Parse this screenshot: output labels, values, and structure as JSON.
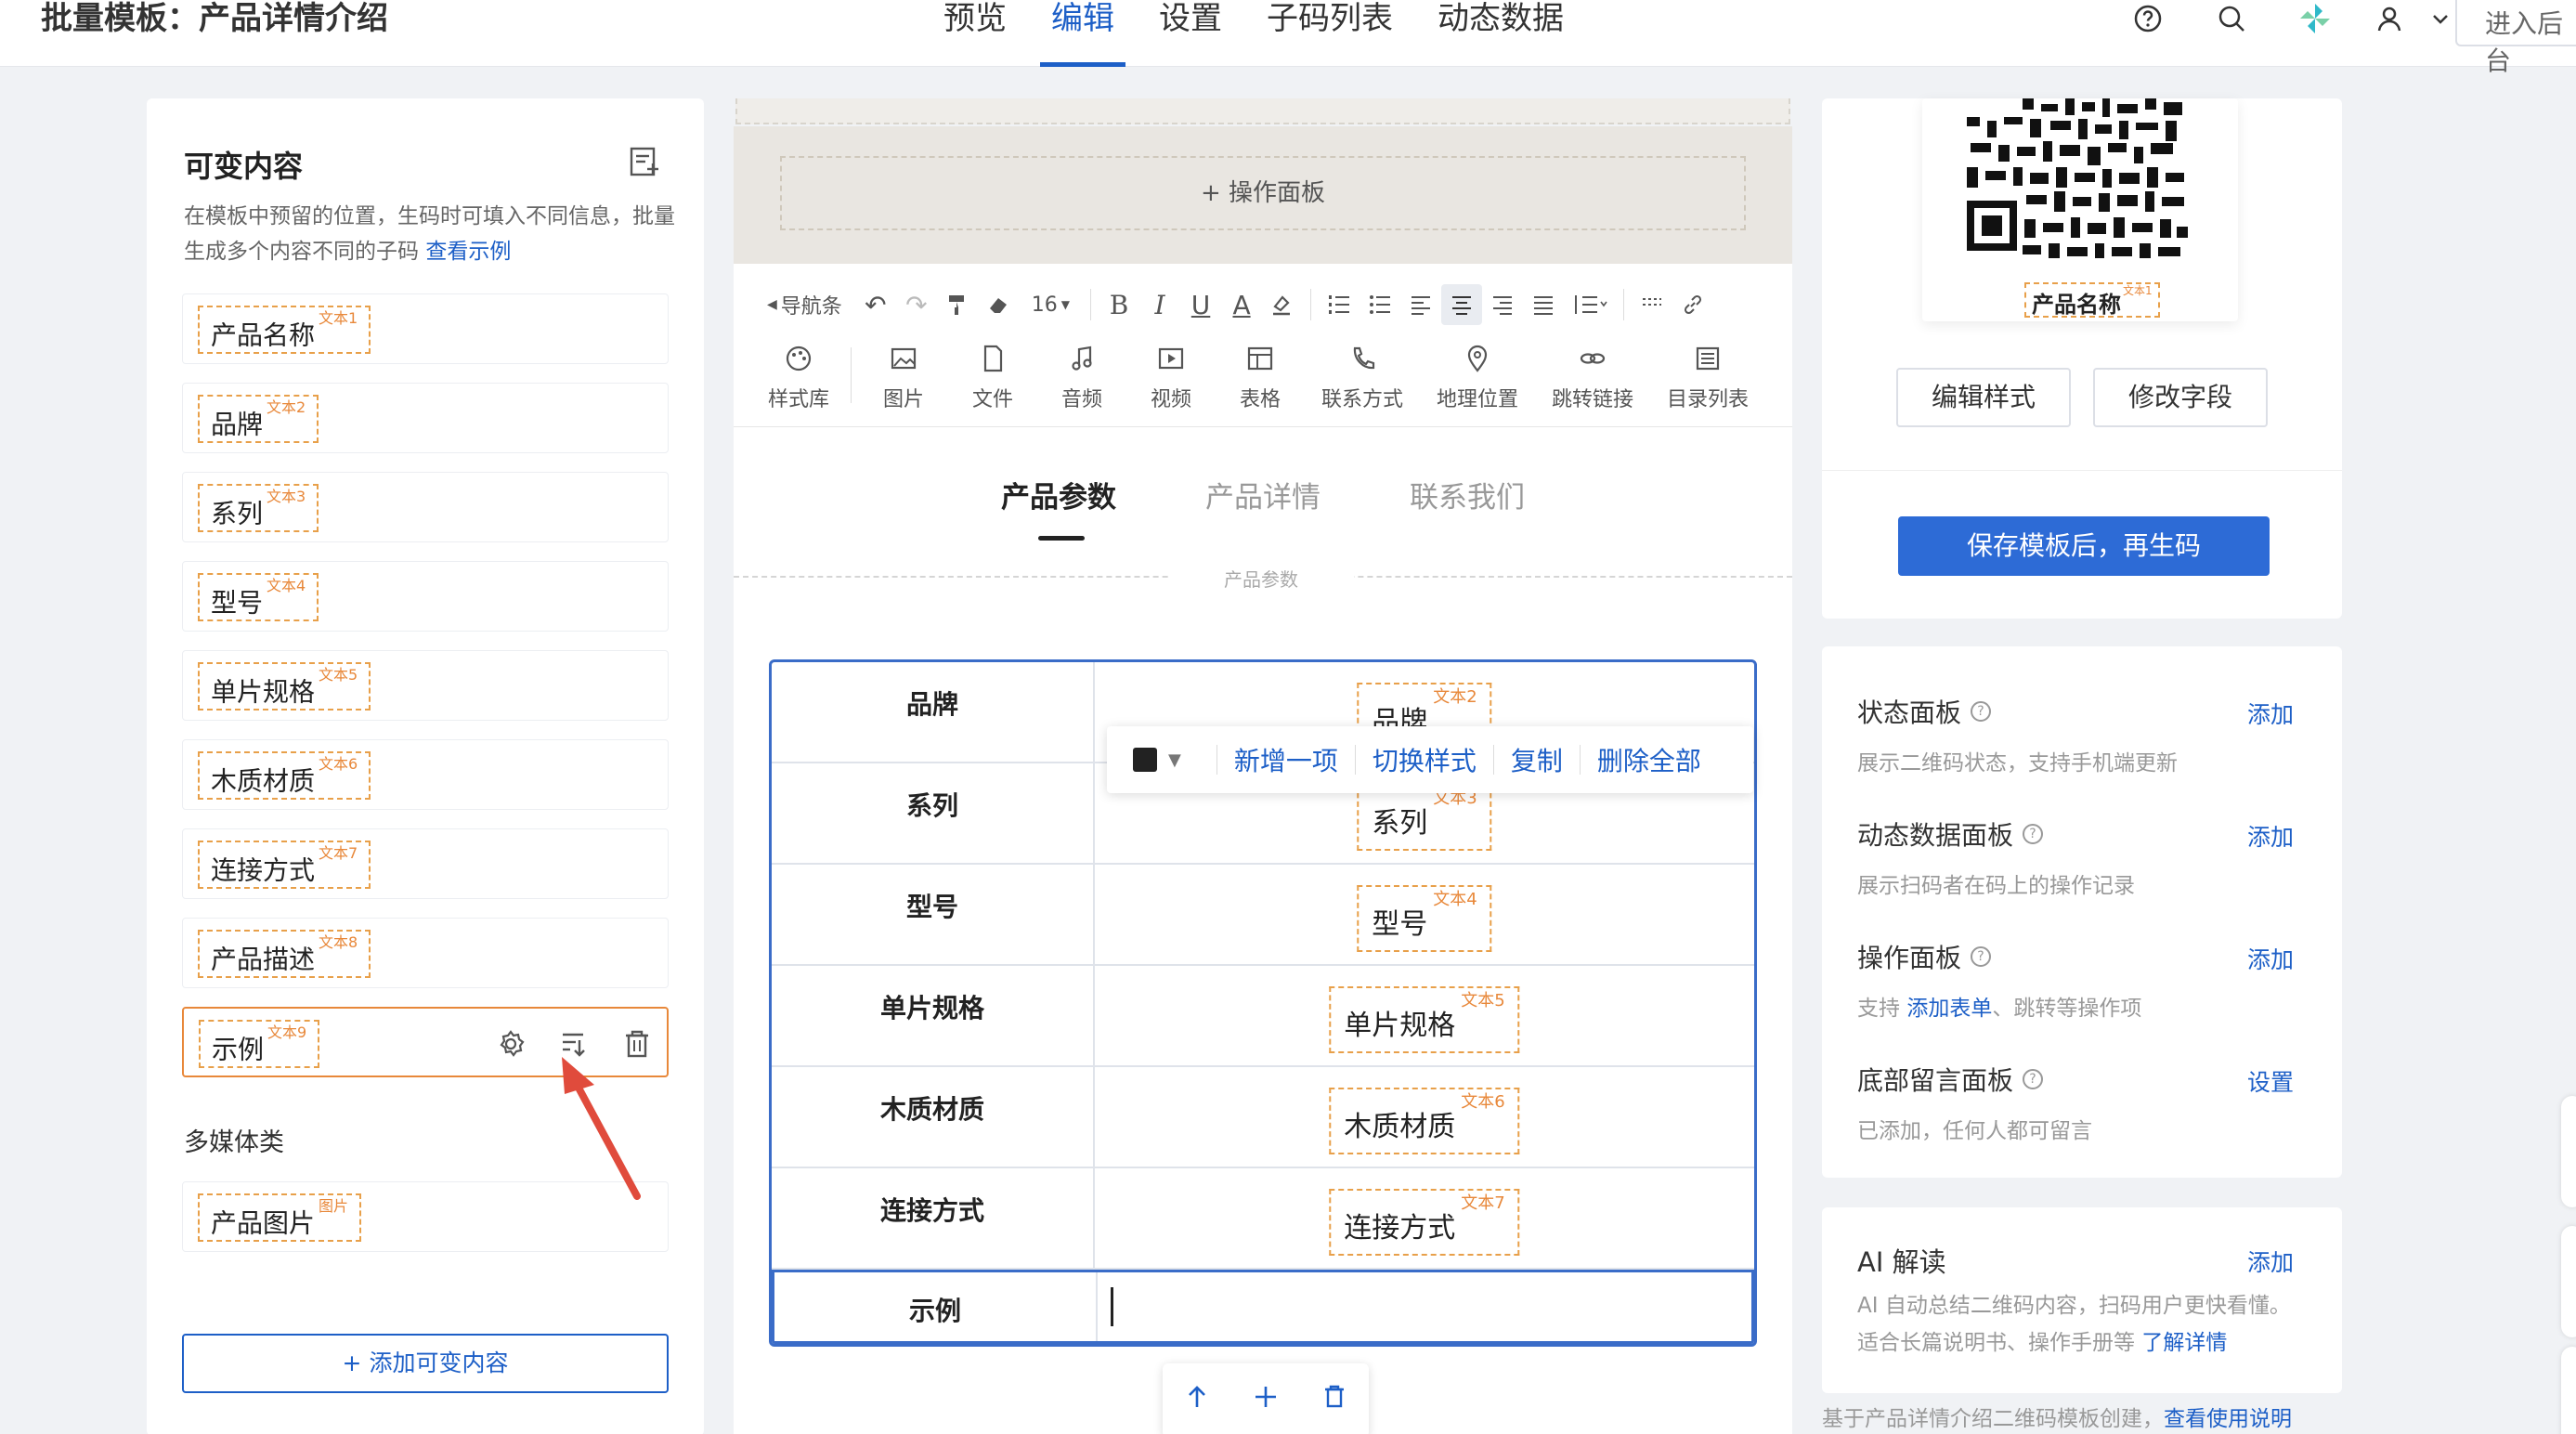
{
  "app": {
    "title": "批量模板：产品详情介绍",
    "enter_button": "进入后台",
    "brand_color": "#1d5fc7"
  },
  "nav": {
    "items": [
      "预览",
      "编辑",
      "设置",
      "子码列表",
      "动态数据"
    ],
    "active": "编辑"
  },
  "top_icons": [
    "help-icon",
    "search-icon",
    "pinwheel-icon",
    "user-icon",
    "chevron-down-icon"
  ],
  "left_panel": {
    "title": "可变内容",
    "desc": "在模板中预留的位置，生码时可填入不同信息，批量生成多个内容不同的子码",
    "example_link": "查看示例",
    "items": [
      {
        "label": "产品名称",
        "badge": "文本1"
      },
      {
        "label": "品牌",
        "badge": "文本2"
      },
      {
        "label": "系列",
        "badge": "文本3"
      },
      {
        "label": "型号",
        "badge": "文本4"
      },
      {
        "label": "单片规格",
        "badge": "文本5"
      },
      {
        "label": "木质材质",
        "badge": "文本6"
      },
      {
        "label": "连接方式",
        "badge": "文本7"
      },
      {
        "label": "产品描述",
        "badge": "文本8"
      },
      {
        "label": "示例",
        "badge": "文本9"
      }
    ],
    "media_section": "多媒体类",
    "media_items": [
      {
        "label": "产品图片",
        "badge": "图片"
      }
    ],
    "add_button": "+ 添加可变内容"
  },
  "editor": {
    "op_panel": "+ 操作面板",
    "toolbar_row1": {
      "nav_bar": "导航条",
      "font_size": "16"
    },
    "toolbar_row2": [
      {
        "label": "样式库",
        "icon": "palette-icon"
      },
      {
        "label": "图片",
        "icon": "image-icon"
      },
      {
        "label": "文件",
        "icon": "file-icon"
      },
      {
        "label": "音频",
        "icon": "music-icon"
      },
      {
        "label": "视频",
        "icon": "video-icon"
      },
      {
        "label": "表格",
        "icon": "table-icon"
      },
      {
        "label": "联系方式",
        "icon": "phone-icon"
      },
      {
        "label": "地理位置",
        "icon": "location-icon"
      },
      {
        "label": "跳转链接",
        "icon": "link-icon"
      },
      {
        "label": "目录列表",
        "icon": "list-icon"
      }
    ],
    "tabs": [
      "产品参数",
      "产品详情",
      "联系我们"
    ],
    "active_tab": "产品参数",
    "section_label": "产品参数",
    "table_rows": [
      {
        "key": "品牌",
        "value": "品牌",
        "badge": "文本2"
      },
      {
        "key": "系列",
        "value": "系列",
        "badge": "文本3"
      },
      {
        "key": "型号",
        "value": "型号",
        "badge": "文本4"
      },
      {
        "key": "单片规格",
        "value": "单片规格",
        "badge": "文本5"
      },
      {
        "key": "木质材质",
        "value": "木质材质",
        "badge": "文本6"
      },
      {
        "key": "连接方式",
        "value": "连接方式",
        "badge": "文本7"
      },
      {
        "key": "示例",
        "value": "",
        "badge": ""
      }
    ],
    "float_menu": {
      "add_item": "新增一项",
      "switch_style": "切换样式",
      "copy": "复制",
      "delete_all": "删除全部"
    }
  },
  "right_panel": {
    "qr_tag": {
      "label": "产品名称",
      "badge": "文本1"
    },
    "edit_style": "编辑样式",
    "modify_field": "修改字段",
    "save_button": "保存模板后，再生码",
    "panels": [
      {
        "title": "状态面板",
        "desc": "展示二维码状态，支持手机端更新",
        "action": "添加"
      },
      {
        "title": "动态数据面板",
        "desc": "展示扫码者在码上的操作记录",
        "action": "添加"
      },
      {
        "title": "操作面板",
        "desc_prefix": "支持 ",
        "desc_link": "添加表单",
        "desc_suffix": "、跳转等操作项",
        "action": "添加"
      },
      {
        "title": "底部留言面板",
        "desc": "已添加，任何人都可留言",
        "action": "设置"
      }
    ],
    "ai": {
      "title": "AI 解读",
      "action": "添加",
      "desc": "AI 自动总结二维码内容，扫码用户更快看懂。适合长篇说明书、操作手册等",
      "link": "了解详情"
    },
    "footer_prefix": "基于产品详情介绍二维码模板创建，",
    "footer_link": "查看使用说明"
  }
}
